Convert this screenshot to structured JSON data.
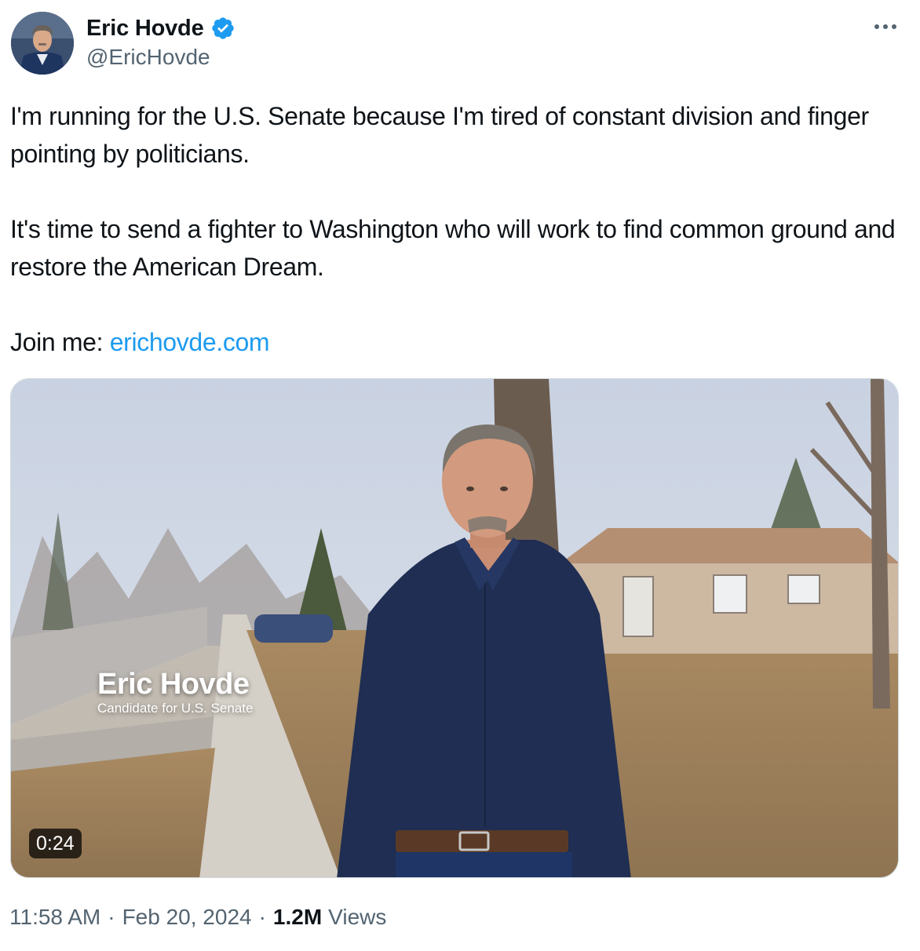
{
  "author": {
    "display_name": "Eric Hovde",
    "handle": "@EricHovde",
    "verified": true,
    "verified_color": "#1d9bf0",
    "avatar_icon": "avatar-photo"
  },
  "more_icon": "more-horizontal-icon",
  "tweet": {
    "paragraph_1": "I'm running for the U.S. Senate because I'm tired of constant division and finger pointing by politicians.",
    "paragraph_2": "It's time to send a fighter to Washington who will work to find common ground and restore the American Dream.",
    "join_prefix": "Join me: ",
    "link_text": "erichovde.com",
    "link_color": "#1d9bf0"
  },
  "video": {
    "overlay_name": "Eric Hovde",
    "overlay_title": "Candidate for U.S. Senate",
    "duration": "0:24"
  },
  "meta": {
    "time": "11:58 AM",
    "separator": "·",
    "date": "Feb 20, 2024",
    "views_count": "1.2M",
    "views_label": "Views"
  },
  "colors": {
    "text_primary": "#0f1419",
    "text_secondary": "#536471",
    "border": "#cfd9de"
  }
}
